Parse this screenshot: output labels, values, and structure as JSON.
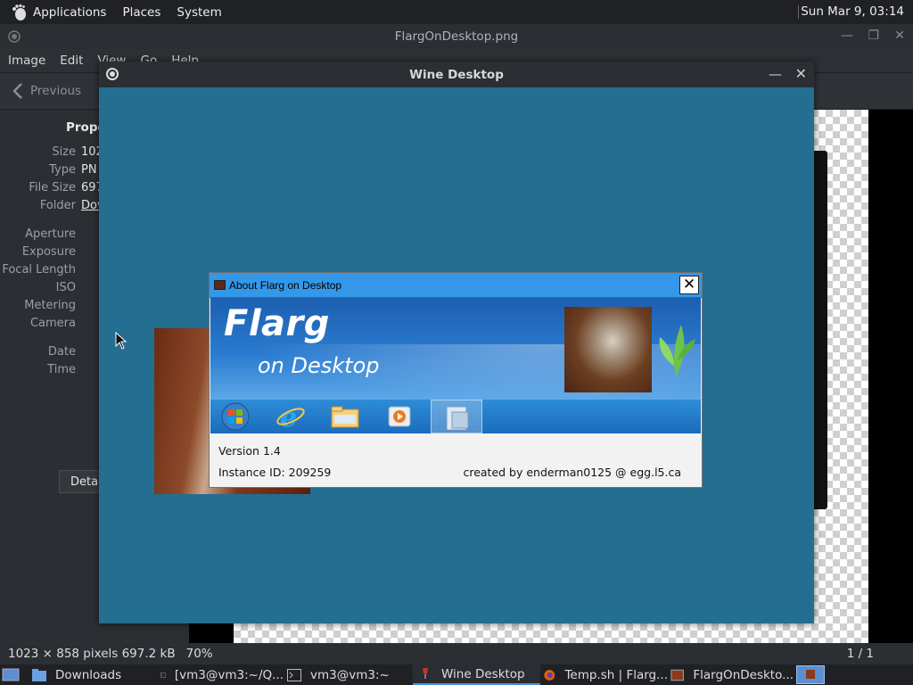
{
  "top_panel": {
    "applications": "Applications",
    "places": "Places",
    "system": "System",
    "clock": "Sun Mar  9, 03:14"
  },
  "viewer": {
    "title": "FlargOnDesktop.png",
    "menu": [
      "Image",
      "Edit",
      "View",
      "Go",
      "Help"
    ],
    "previous": "Previous",
    "properties_heading": "Prope",
    "properties": [
      {
        "key": "Size",
        "value": "102"
      },
      {
        "key": "Type",
        "value": "PN"
      },
      {
        "key": "File Size",
        "value": "697"
      },
      {
        "key": "Folder",
        "value": "Dov"
      },
      {
        "key": "Aperture",
        "value": ""
      },
      {
        "key": "Exposure",
        "value": ""
      },
      {
        "key": "Focal Length",
        "value": ""
      },
      {
        "key": "ISO",
        "value": ""
      },
      {
        "key": "Metering",
        "value": ""
      },
      {
        "key": "Camera",
        "value": ""
      },
      {
        "key": "Date",
        "value": ""
      },
      {
        "key": "Time",
        "value": ""
      }
    ],
    "details_button": "Detai",
    "status_dims": "1023 × 858 pixels  697.2 kB",
    "status_zoom": "70%",
    "status_page": "1 / 1"
  },
  "wine": {
    "title": "Wine Desktop"
  },
  "about": {
    "title": "About Flarg on Desktop",
    "close": "✕",
    "banner_title": "Flarg",
    "banner_subtitle": "on Desktop",
    "version": "Version 1.4",
    "instance": "Instance ID: 209259",
    "credit": "created by enderman0125 @ egg.l5.ca"
  },
  "taskbar": {
    "items": [
      {
        "label": "Downloads"
      },
      {
        "label": "[vm3@vm3:~/Q..."
      },
      {
        "label": "vm3@vm3:~"
      },
      {
        "label": "Wine Desktop"
      },
      {
        "label": "Temp.sh | Flarg..."
      },
      {
        "label": "FlargOnDeskto..."
      }
    ]
  },
  "colors": {
    "wine_desktop": "#236e91",
    "dialog_titlebar": "#3597e8",
    "panel": "#1f2124"
  }
}
